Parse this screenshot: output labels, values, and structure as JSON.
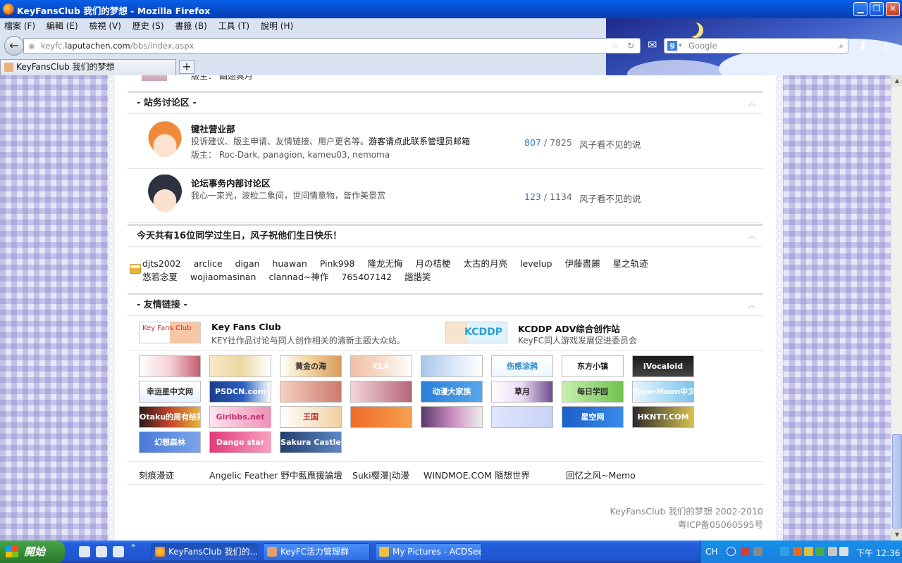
{
  "window": {
    "title": "KeyFansClub 我们的梦想 - Mozilla Firefox"
  },
  "menu": [
    "檔案 (F)",
    "編輯 (E)",
    "檢視 (V)",
    "歷史 (S)",
    "書籤 (B)",
    "工具 (T)",
    "說明 (H)"
  ],
  "nav": {
    "url_prefix": "keyfc.",
    "url_host": "laputachen.com",
    "url_path": "/bbs/index.aspx",
    "search_placeholder": "Google"
  },
  "tab": {
    "title": "KeyFansClub 我们的梦想"
  },
  "prev_forum": {
    "mods": "版主：  幽翅真月"
  },
  "sections": {
    "site": {
      "title": "- 站务讨论区 -"
    },
    "birthday": {
      "title": "今天共有16位同学过生日，风子祝他们生日快乐！"
    },
    "links": {
      "title": "- 友情链接 -"
    }
  },
  "forums": [
    {
      "name": "键社营业部",
      "desc": "投诉建议、版主申请、友情链接、用户更名等。",
      "desc_bold": "游客请点此联系管理员邮箱",
      "mods": "版主：  Roc-Dark, panagion, kameu03, nemoma",
      "topics": "807",
      "posts": "7825",
      "last": "风子看不见的说"
    },
    {
      "name": "论坛事务内部讨论区",
      "desc": "我心一束光，波粒二象间，世间情意物，皆作美景赏",
      "mods": "",
      "topics": "123",
      "posts": "1134",
      "last": "风子看不见的说"
    }
  ],
  "birthdays": [
    "djts2002",
    "arclice",
    "digan",
    "huawan",
    "Pink998",
    "隆龙无悔",
    "月の桔梗",
    "太古的月亮",
    "levelup",
    "伊藤盡麗",
    "星之轨迹",
    "悠若念夏",
    "wojiaomasinan",
    "clannad~神作",
    "765407142",
    "諧諧笑"
  ],
  "featured_links": [
    {
      "name": "Key Fans Club",
      "desc": "KEY社作品讨论与同人创作相关的清新主题大众站。",
      "logo_text": "Key Fans Club"
    },
    {
      "name": "KCDDP ADV综合创作站",
      "desc": "KeyFC同人游戏发展促进委员会",
      "logo_text": "KCDDP"
    }
  ],
  "banners": [
    "",
    "",
    "黄金の海",
    "CLA",
    "",
    "伤感涂鸦",
    "东方小镇",
    "iVocaloid",
    "幸运星中文网",
    "PSDCN.com",
    "",
    "",
    "动漫大家族",
    "草月",
    "每日学园",
    "Type-Moon中文網",
    "Otaku的周有结界",
    "Girlbbs.net",
    "王国",
    "",
    "",
    "",
    "星空网",
    "HKNTT.COM",
    "幻想森林",
    "Dango star",
    "Sakura Castle",
    ""
  ],
  "text_links": [
    "刻痕漫迹",
    "Angelic Feather 野中藍應援論壇",
    "Suki樱漫|动漫",
    "WINDMOE.COM 隨想世界",
    "回忆之风~Memo"
  ],
  "footer": {
    "line1": "KeyFansClub 我们的梦想 2002-2010",
    "line2": "粤ICP备05060595号"
  },
  "taskbar": {
    "start": "開始",
    "tasks": [
      "KeyFansClub 我们的...",
      "KeyFC活力管理群",
      "My Pictures - ACDSee..."
    ],
    "lang": "CH",
    "clock": "下午 12:36"
  }
}
